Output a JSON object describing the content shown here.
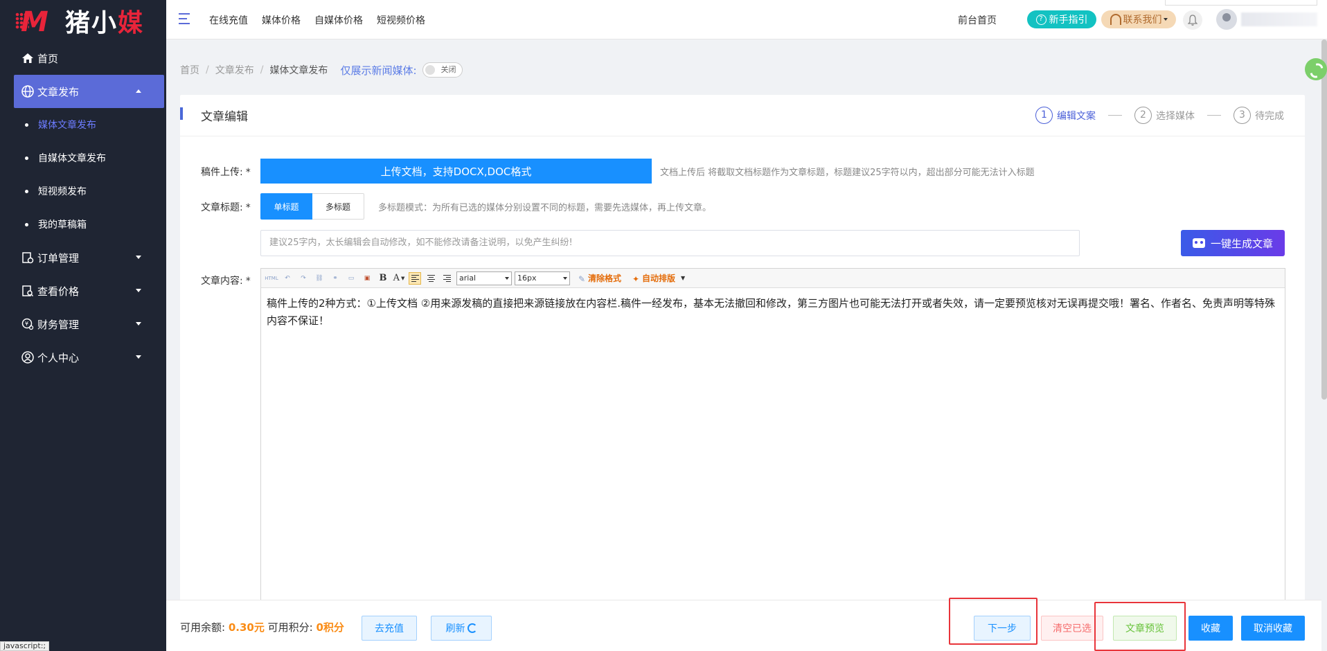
{
  "brand": {
    "logo_text_a": "猪",
    "logo_text_b": "小",
    "logo_text_c": "媒",
    "accent": "#5b6bd8",
    "logo_red": "#e8243a"
  },
  "sidebar": {
    "home": "首页",
    "article_publish": "文章发布",
    "sub_items": [
      "媒体文章发布",
      "自媒体文章发布",
      "短视频发布",
      "我的草稿箱"
    ],
    "order_mgmt": "订单管理",
    "view_price": "查看价格",
    "finance_mgmt": "财务管理",
    "personal_center": "个人中心"
  },
  "header": {
    "menu": [
      "在线充值",
      "媒体价格",
      "自媒体价格",
      "短视频价格"
    ],
    "front_home": "前台首页",
    "guide": "新手指引",
    "contact": "联系我们"
  },
  "breadcrumb": {
    "items": [
      "首页",
      "文章发布",
      "媒体文章发布"
    ],
    "only_news_label": "仅展示新闻媒体:",
    "toggle_label": "关闭"
  },
  "card": {
    "title": "文章编辑",
    "steps": [
      {
        "num": "1",
        "label": "编辑文案"
      },
      {
        "num": "2",
        "label": "选择媒体"
      },
      {
        "num": "3",
        "label": "待完成"
      }
    ]
  },
  "form": {
    "upload_label": "稿件上传:",
    "upload_button": "上传文档，支持DOCX,DOC格式",
    "upload_hint": "文档上传后 将截取文档标题作为文章标题，标题建议25字符以内，超出部分可能无法计入标题",
    "title_label": "文章标题:",
    "single_title": "单标题",
    "multi_title": "多标题",
    "multi_hint": "多标题模式：为所有已选的媒体分别设置不同的标题，需要先选媒体，再上传文章。",
    "title_placeholder": "建议25字内，太长编辑会自动修改，如不能修改请备注说明，以免产生纠纷!",
    "ai_button": "一键生成文章",
    "content_label": "文章内容:",
    "required_mark": "*"
  },
  "editor": {
    "font_family": "arial",
    "font_size": "16px",
    "clear_format": "清除格式",
    "auto_layout": "自动排版",
    "bold": "B",
    "font_color": "A",
    "html_icon": "HTML",
    "content": "稿件上传的2种方式：①上传文档 ②用来源发稿的直接把来源链接放在内容栏.稿件一经发布，基本无法撤回和修改，第三方图片也可能无法打开或者失效，请一定要预览核对无误再提交哦！署名、作者名、免责声明等特殊内容不保证！"
  },
  "bottom": {
    "balance_label": "可用余额:",
    "balance_value": "0.30元",
    "points_label": "可用积分:",
    "points_value": "0积分",
    "recharge": "去充值",
    "refresh": "刷新",
    "next": "下一步",
    "clear_selected": "清空已选",
    "preview": "文章预览",
    "collect": "收藏",
    "uncollect": "取消收藏"
  },
  "status_bar": "javascript:;"
}
